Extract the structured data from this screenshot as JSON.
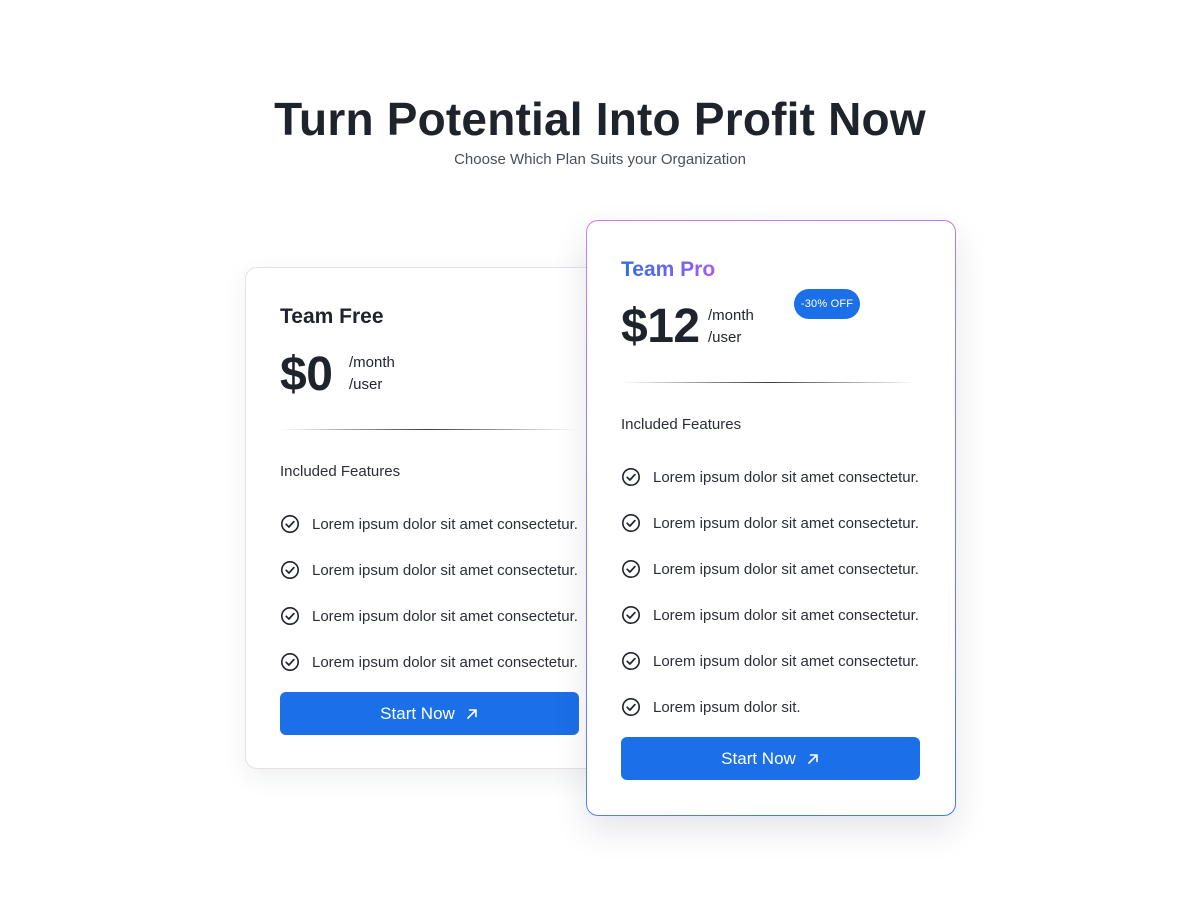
{
  "hero": {
    "title": "Turn Potential Into Profit Now",
    "subtitle": "Choose Which Plan Suits your Organization"
  },
  "plans": [
    {
      "name": "Team Free",
      "price": "$0",
      "period_line1": "/month",
      "period_line2": "/user",
      "features_label": "Included Features",
      "features": [
        "Lorem ipsum dolor sit amet consectetur.",
        "Lorem ipsum dolor sit amet consectetur.",
        "Lorem ipsum dolor sit amet consectetur.",
        "Lorem ipsum dolor sit amet consectetur."
      ],
      "button_label": "Start Now"
    },
    {
      "name": "Team Pro",
      "price": "$12",
      "period_line1": "/month",
      "period_line2": "/user",
      "badge": "-30% OFF",
      "features_label": "Included Features",
      "features": [
        "Lorem ipsum dolor sit amet consectetur.",
        "Lorem ipsum dolor sit amet consectetur.",
        "Lorem ipsum dolor sit amet consectetur.",
        "Lorem ipsum dolor sit amet consectetur.",
        "Lorem ipsum dolor sit amet consectetur.",
        "Lorem ipsum dolor sit."
      ],
      "button_label": "Start Now"
    }
  ],
  "icons": {
    "feature": "check-circle-icon",
    "button": "arrow-up-right-icon"
  },
  "colors": {
    "accent": "#1b6fe8",
    "pro_gradient_start": "#2f6fe6",
    "pro_gradient_end": "#a45cf0",
    "text": "#1f232b"
  }
}
